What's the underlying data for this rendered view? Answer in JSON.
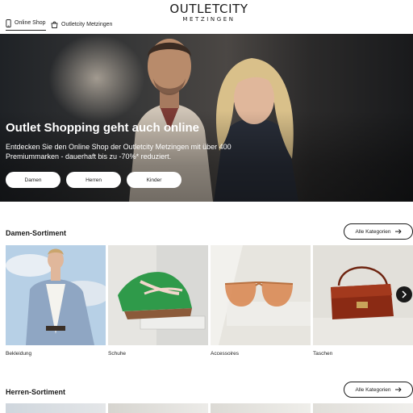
{
  "header": {
    "logo_main": "OUTLETCITY",
    "logo_sub": "METZINGEN",
    "tabs": [
      {
        "label": "Online Shop",
        "icon": "phone-icon",
        "active": true
      },
      {
        "label": "Outletcity Metzingen",
        "icon": "store-bag-icon",
        "active": false
      }
    ]
  },
  "hero": {
    "title": "Outlet Shopping geht auch online",
    "text": "Entdecken Sie den Online Shop der Outletcity Metzingen mit über 400 Premiummarken - dauerhaft bis zu -70%* reduziert.",
    "buttons": [
      "Damen",
      "Herren",
      "Kinder"
    ]
  },
  "women_section": {
    "title": "Damen-Sortiment",
    "all_categories_label": "Alle Kategorien",
    "categories": [
      "Bekleidung",
      "Schuhe",
      "Accessoires",
      "Taschen"
    ]
  },
  "men_section": {
    "title": "Herren-Sortiment",
    "all_categories_label": "Alle Kategorien"
  },
  "colors": {
    "text": "#1a1a1a",
    "shoe_green": "#2f9a4a",
    "bag_red": "#8a2a14",
    "sunglasses": "#d98a55"
  }
}
